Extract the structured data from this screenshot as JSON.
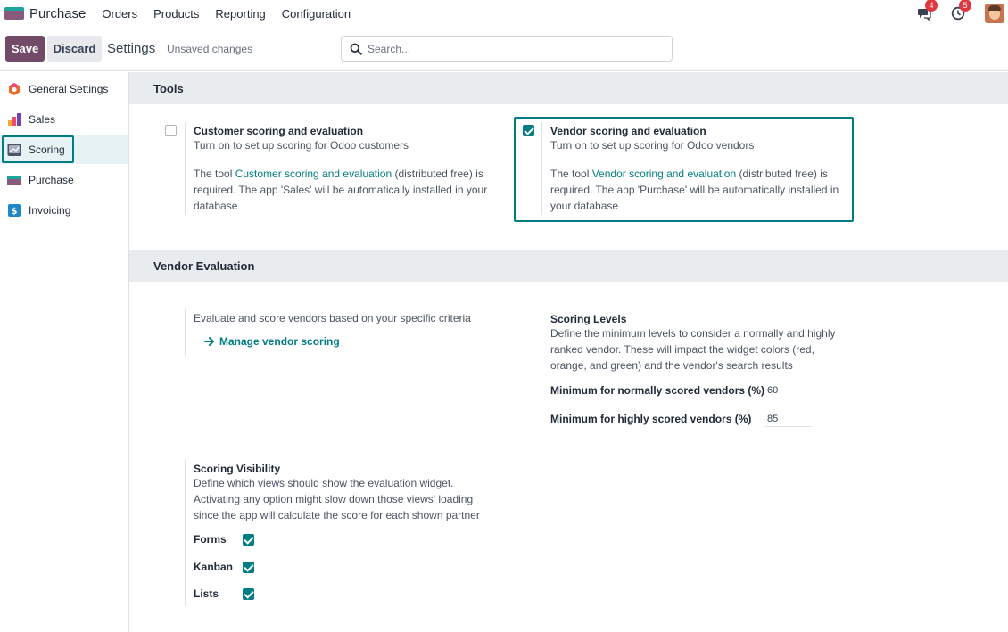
{
  "navbar": {
    "app_name": "Purchase",
    "menu": [
      "Orders",
      "Products",
      "Reporting",
      "Configuration"
    ],
    "messages_badge": "4",
    "activities_badge": "5"
  },
  "control_panel": {
    "save_label": "Save",
    "discard_label": "Discard",
    "title": "Settings",
    "unsaved": "Unsaved changes",
    "search_placeholder": "Search..."
  },
  "sidebar": {
    "items": [
      {
        "label": "General Settings",
        "icon": "odoo-icon"
      },
      {
        "label": "Sales",
        "icon": "sales-icon"
      },
      {
        "label": "Scoring",
        "icon": "scoring-icon",
        "active": true
      },
      {
        "label": "Purchase",
        "icon": "purchase-icon"
      },
      {
        "label": "Invoicing",
        "icon": "invoicing-icon"
      }
    ]
  },
  "tools": {
    "header": "Tools",
    "customer": {
      "title": "Customer scoring and evaluation",
      "subtitle": "Turn on to set up scoring for Odoo customers",
      "text_pre": "The tool ",
      "link": "Customer scoring and evaluation",
      "text_line1_post": " (distributed free) is",
      "text_line2": "required. The app 'Sales' will be automatically installed in your",
      "text_line3": "database",
      "checked": false
    },
    "vendor": {
      "title": "Vendor scoring and evaluation",
      "subtitle": "Turn on to set up scoring for Odoo vendors",
      "text_pre": "The tool ",
      "link": "Vendor scoring and evaluation",
      "text_line1_post": " (distributed free) is",
      "text_line2": "required. The app 'Purchase' will be automatically installed in",
      "text_line3": "your database",
      "checked": true
    }
  },
  "vendor_evaluation": {
    "header": "Vendor Evaluation",
    "description": "Evaluate and score vendors based on your specific criteria",
    "manage_link": "Manage vendor scoring",
    "scoring_levels": {
      "title": "Scoring Levels",
      "line1": "Define the minimum levels to consider a normally and highly",
      "line2": "ranked vendor. These will impact the widget colors (red,",
      "line3": "orange, and green) and the vendor's search results",
      "normal_label": "Minimum for normally scored vendors (%)",
      "normal_value": "60",
      "high_label": "Minimum for highly scored vendors (%)",
      "high_value": "85"
    },
    "visibility": {
      "title": "Scoring Visibility",
      "line1": "Define which views should show the evaluation widget.",
      "line2": "Activating any option might slow down those views' loading",
      "line3": "since the app will calculate the score for each shown partner",
      "options": [
        {
          "label": "Forms",
          "checked": true
        },
        {
          "label": "Kanban",
          "checked": true
        },
        {
          "label": "Lists",
          "checked": true
        }
      ]
    }
  }
}
